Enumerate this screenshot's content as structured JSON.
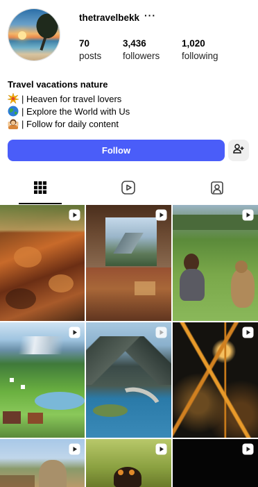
{
  "profile": {
    "username": "thetravelbekk",
    "more_label": "···",
    "stats": [
      {
        "value": "70",
        "label": "posts"
      },
      {
        "value": "3,436",
        "label": "followers"
      },
      {
        "value": "1,020",
        "label": "following"
      }
    ]
  },
  "bio": {
    "title": "Travel vacations nature",
    "lines": [
      {
        "emoji": "sparkle-burst",
        "text": "| Heaven for travel lovers"
      },
      {
        "emoji": "globe",
        "text": "| Explore the World with Us"
      },
      {
        "emoji": "person-shrugging",
        "text": "| Follow for daily content"
      }
    ]
  },
  "actions": {
    "follow_label": "Follow",
    "add_user_icon": "add-user-icon"
  },
  "tabs": [
    {
      "name": "posts",
      "icon": "grid-icon",
      "active": true
    },
    {
      "name": "reels",
      "icon": "reels-icon",
      "active": false
    },
    {
      "name": "tagged",
      "icon": "tagged-icon",
      "active": false
    }
  ],
  "grid_posts": [
    {
      "subject": "autumn leaves",
      "is_reel": true
    },
    {
      "subject": "mountain cafe terrace",
      "is_reel": true
    },
    {
      "subject": "girl with deer in meadow",
      "is_reel": true
    },
    {
      "subject": "alpine village valley",
      "is_reel": true
    },
    {
      "subject": "fjord bridge",
      "is_reel": true
    },
    {
      "subject": "city lights aerial",
      "is_reel": true
    },
    {
      "subject": "elephant in village",
      "is_reel": true
    },
    {
      "subject": "jumping spider",
      "is_reel": true
    },
    {
      "subject": "dark scene",
      "is_reel": true
    }
  ],
  "colors": {
    "accent": "#4a5df9",
    "secondary_button": "#efefef"
  }
}
